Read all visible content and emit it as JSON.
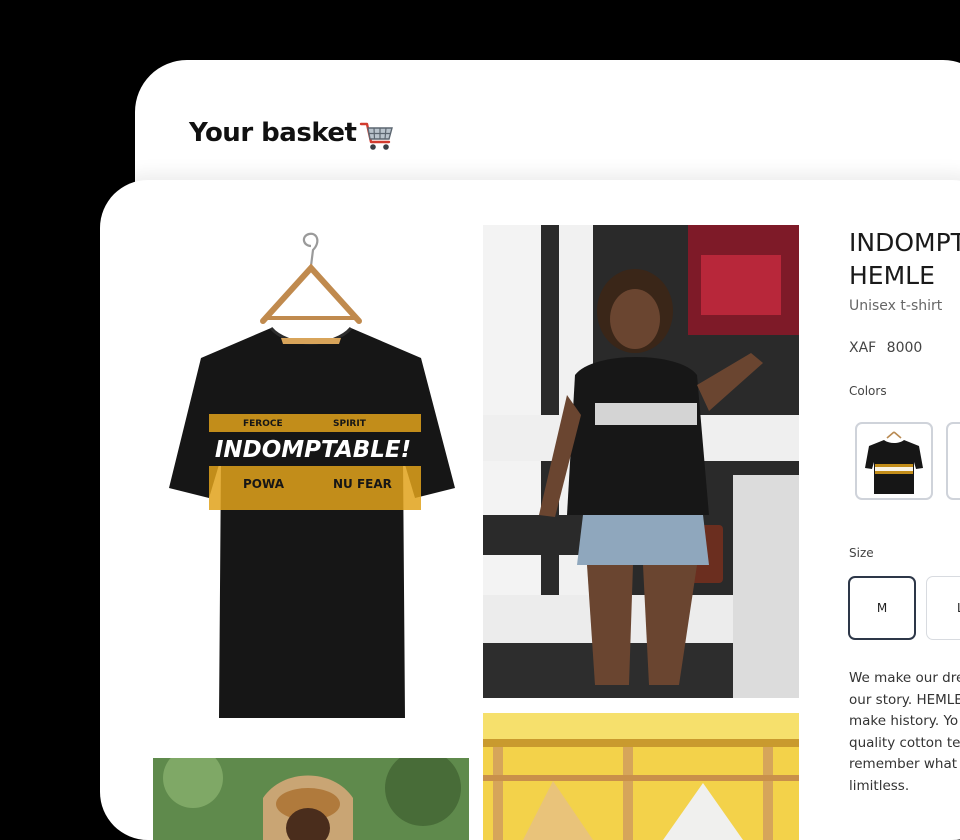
{
  "basket": {
    "title": "Your basket",
    "cart_icon": "shopping-cart-icon"
  },
  "product": {
    "title": "INDOMPT\nHEMLE",
    "subtitle": "Unisex t-shirt",
    "price": "XAF 8000",
    "colors_label": "Colors",
    "size_label": "Size",
    "sizes": [
      {
        "label": "M",
        "selected": true
      },
      {
        "label": "L",
        "selected": false
      }
    ],
    "description": "We make our dre\nour story. HEMLE\nmake history. Yo\nquality cotton te\nremember what\nlimitless.",
    "shirt_print": "INDOMPTABLE!"
  },
  "colors": {
    "selected_border": "#2d3748",
    "swatch_border": "#cfd3da",
    "print_gold": "#e0a21b"
  }
}
